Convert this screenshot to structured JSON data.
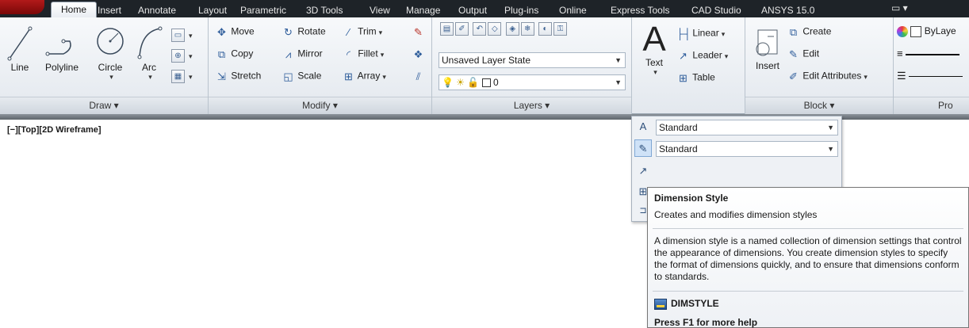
{
  "tabs": [
    "Home",
    "Insert",
    "Annotate",
    "Layout",
    "Parametric",
    "3D Tools",
    "View",
    "Manage",
    "Output",
    "Plug-ins",
    "Online",
    "Express Tools",
    "CAD Studio",
    "ANSYS 15.0"
  ],
  "tab_extra": "▭ ▾",
  "draw": {
    "title": "Draw ▾",
    "line": "Line",
    "polyline": "Polyline",
    "circle": "Circle",
    "arc": "Arc"
  },
  "modify": {
    "title": "Modify ▾",
    "move": "Move",
    "rotate": "Rotate",
    "trim": "Trim",
    "copy": "Copy",
    "mirror": "Mirror",
    "fillet": "Fillet",
    "stretch": "Stretch",
    "scale": "Scale",
    "array": "Array"
  },
  "layers": {
    "title": "Layers ▾",
    "layer_state": "Unsaved Layer State",
    "current_layer": "0"
  },
  "annotation": {
    "text": "Text",
    "linear": "Linear",
    "leader": "Leader",
    "table": "Table"
  },
  "block": {
    "title": "Block ▾",
    "insert": "Insert",
    "create": "Create",
    "edit": "Edit",
    "edit_attributes": "Edit Attributes"
  },
  "properties": {
    "title": "Pro",
    "color": "ByLaye"
  },
  "viewport_label": "[−][Top][2D Wireframe]",
  "flyout": {
    "text_style": "Standard",
    "dim_style": "Standard"
  },
  "tooltip": {
    "title": "Dimension Style",
    "short": "Creates and modifies dimension styles",
    "long": "A dimension style is a named collection of dimension settings that control the appearance of dimensions. You create dimension styles to specify the format of dimensions quickly, and to ensure that dimensions conform to standards.",
    "command": "DIMSTYLE",
    "help": "Press F1 for more help"
  },
  "colors": {
    "tabbar": "#1e2328",
    "ribbon": "#e3e8ee",
    "accent": "#2d5c9a"
  }
}
